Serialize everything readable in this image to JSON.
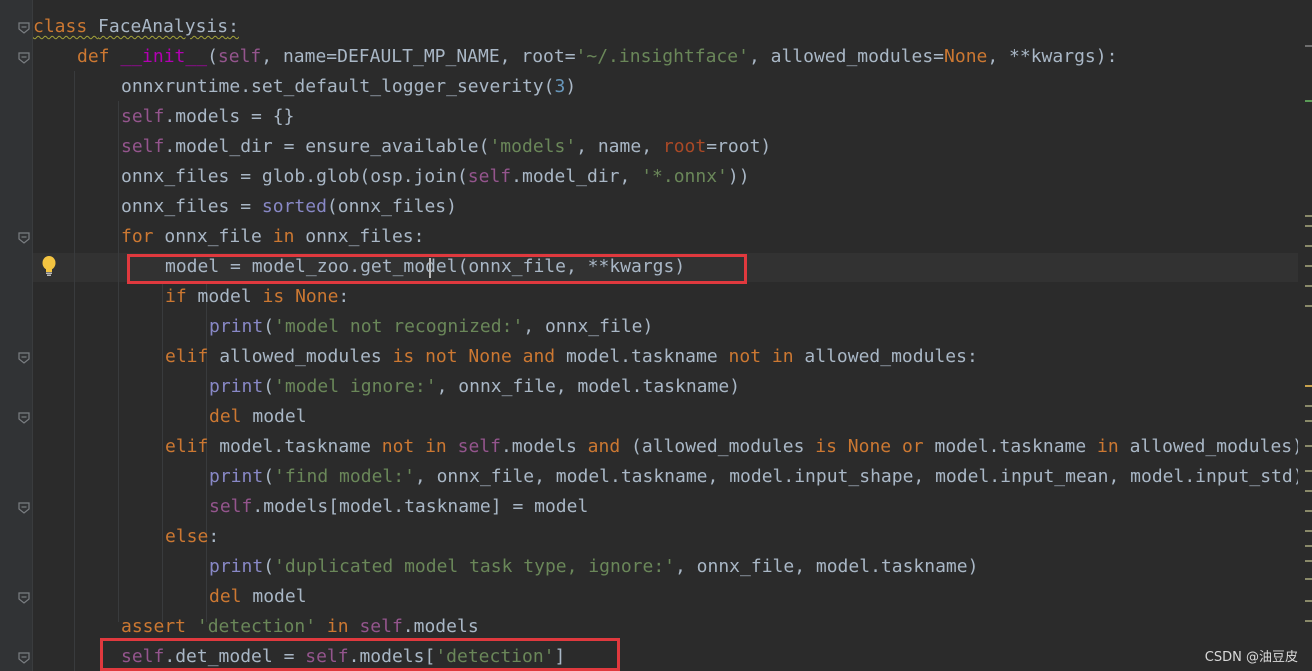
{
  "editor": {
    "language": "Python",
    "lines": [
      {
        "indent": 0,
        "tokens": [
          {
            "t": "class ",
            "c": "kw squiggle"
          },
          {
            "t": "FaceAnalysis",
            "c": "squiggle"
          },
          {
            "t": ":",
            "c": "squiggle"
          }
        ]
      },
      {
        "indent": 1,
        "tokens": [
          {
            "t": "def ",
            "c": "kw"
          },
          {
            "t": "__init__",
            "c": "mag"
          },
          {
            "t": "(",
            "c": ""
          },
          {
            "t": "self",
            "c": "self"
          },
          {
            "t": ", name=DEFAULT_MP_NAME, root=",
            "c": ""
          },
          {
            "t": "'~/.insightface'",
            "c": "str"
          },
          {
            "t": ", allowed_modules=",
            "c": ""
          },
          {
            "t": "None",
            "c": "kw"
          },
          {
            "t": ", **kwargs):",
            "c": ""
          }
        ]
      },
      {
        "indent": 2,
        "tokens": [
          {
            "t": "onnxruntime.set_default_logger_severity(",
            "c": ""
          },
          {
            "t": "3",
            "c": "num"
          },
          {
            "t": ")",
            "c": ""
          }
        ]
      },
      {
        "indent": 2,
        "tokens": [
          {
            "t": "self",
            "c": "self"
          },
          {
            "t": ".models = {}",
            "c": ""
          }
        ]
      },
      {
        "indent": 2,
        "tokens": [
          {
            "t": "self",
            "c": "self"
          },
          {
            "t": ".model_dir = ensure_available(",
            "c": ""
          },
          {
            "t": "'models'",
            "c": "str"
          },
          {
            "t": ", name, ",
            "c": ""
          },
          {
            "t": "root",
            "c": "param"
          },
          {
            "t": "=root)",
            "c": ""
          }
        ]
      },
      {
        "indent": 2,
        "tokens": [
          {
            "t": "onnx_files = glob.glob(osp.join(",
            "c": ""
          },
          {
            "t": "self",
            "c": "self"
          },
          {
            "t": ".model_dir, ",
            "c": ""
          },
          {
            "t": "'*.onnx'",
            "c": "str"
          },
          {
            "t": "))",
            "c": ""
          }
        ]
      },
      {
        "indent": 2,
        "tokens": [
          {
            "t": "onnx_files = ",
            "c": ""
          },
          {
            "t": "sorted",
            "c": "builtin"
          },
          {
            "t": "(onnx_files)",
            "c": ""
          }
        ]
      },
      {
        "indent": 2,
        "tokens": [
          {
            "t": "for ",
            "c": "kw"
          },
          {
            "t": "onnx_file ",
            "c": ""
          },
          {
            "t": "in ",
            "c": "kw"
          },
          {
            "t": "onnx_files:",
            "c": ""
          }
        ]
      },
      {
        "indent": 3,
        "tokens": [
          {
            "t": "model = model_zoo.get_model(onnx_file, **kwargs)",
            "c": ""
          }
        ]
      },
      {
        "indent": 3,
        "tokens": [
          {
            "t": "if ",
            "c": "kw"
          },
          {
            "t": "model ",
            "c": ""
          },
          {
            "t": "is ",
            "c": "kw"
          },
          {
            "t": "None",
            "c": "kw"
          },
          {
            "t": ":",
            "c": ""
          }
        ]
      },
      {
        "indent": 4,
        "tokens": [
          {
            "t": "print",
            "c": "builtin"
          },
          {
            "t": "(",
            "c": ""
          },
          {
            "t": "'model not recognized:'",
            "c": "str"
          },
          {
            "t": ", onnx_file)",
            "c": ""
          }
        ]
      },
      {
        "indent": 3,
        "tokens": [
          {
            "t": "elif ",
            "c": "kw"
          },
          {
            "t": "allowed_modules ",
            "c": ""
          },
          {
            "t": "is not None and ",
            "c": "kw"
          },
          {
            "t": "model.taskname ",
            "c": ""
          },
          {
            "t": "not in ",
            "c": "kw"
          },
          {
            "t": "allowed_modules:",
            "c": ""
          }
        ]
      },
      {
        "indent": 4,
        "tokens": [
          {
            "t": "print",
            "c": "builtin"
          },
          {
            "t": "(",
            "c": ""
          },
          {
            "t": "'model ignore:'",
            "c": "str"
          },
          {
            "t": ", onnx_file, model.taskname)",
            "c": ""
          }
        ]
      },
      {
        "indent": 4,
        "tokens": [
          {
            "t": "del ",
            "c": "kw"
          },
          {
            "t": "model",
            "c": ""
          }
        ]
      },
      {
        "indent": 3,
        "tokens": [
          {
            "t": "elif ",
            "c": "kw"
          },
          {
            "t": "model.taskname ",
            "c": ""
          },
          {
            "t": "not in ",
            "c": "kw"
          },
          {
            "t": "self",
            "c": "self"
          },
          {
            "t": ".models ",
            "c": ""
          },
          {
            "t": "and ",
            "c": "kw"
          },
          {
            "t": "(allowed_modules ",
            "c": ""
          },
          {
            "t": "is None or ",
            "c": "kw"
          },
          {
            "t": "model.taskname ",
            "c": ""
          },
          {
            "t": "in ",
            "c": "kw"
          },
          {
            "t": "allowed_modules):",
            "c": ""
          }
        ]
      },
      {
        "indent": 4,
        "tokens": [
          {
            "t": "print",
            "c": "builtin"
          },
          {
            "t": "(",
            "c": ""
          },
          {
            "t": "'find model:'",
            "c": "str"
          },
          {
            "t": ", onnx_file, model.taskname, model.input_shape, model.input_mean, model.input_std)",
            "c": ""
          }
        ]
      },
      {
        "indent": 4,
        "tokens": [
          {
            "t": "self",
            "c": "self"
          },
          {
            "t": ".models[model.taskname] = model",
            "c": ""
          }
        ]
      },
      {
        "indent": 3,
        "tokens": [
          {
            "t": "else",
            "c": "kw"
          },
          {
            "t": ":",
            "c": ""
          }
        ]
      },
      {
        "indent": 4,
        "tokens": [
          {
            "t": "print",
            "c": "builtin"
          },
          {
            "t": "(",
            "c": ""
          },
          {
            "t": "'duplicated model task type, ignore:'",
            "c": "str"
          },
          {
            "t": ", onnx_file, model.taskname)",
            "c": ""
          }
        ]
      },
      {
        "indent": 4,
        "tokens": [
          {
            "t": "del ",
            "c": "kw"
          },
          {
            "t": "model",
            "c": ""
          }
        ]
      },
      {
        "indent": 2,
        "tokens": [
          {
            "t": "assert ",
            "c": "kw"
          },
          {
            "t": "'detection'",
            "c": "str"
          },
          {
            "t": " ",
            "c": ""
          },
          {
            "t": "in ",
            "c": "kw"
          },
          {
            "t": "self",
            "c": "self"
          },
          {
            "t": ".models",
            "c": ""
          }
        ]
      },
      {
        "indent": 2,
        "tokens": [
          {
            "t": "self",
            "c": "self"
          },
          {
            "t": ".det_model = ",
            "c": ""
          },
          {
            "t": "self",
            "c": "self"
          },
          {
            "t": ".models[",
            "c": ""
          },
          {
            "t": "'detection'",
            "c": "str"
          },
          {
            "t": "]",
            "c": ""
          }
        ]
      }
    ]
  },
  "colors": {
    "background": "#2b2b2b",
    "keyword": "#cc7832",
    "string": "#6a8759",
    "self": "#94558d",
    "highlight_box": "#e0393e"
  },
  "watermark": "CSDN @油豆皮"
}
